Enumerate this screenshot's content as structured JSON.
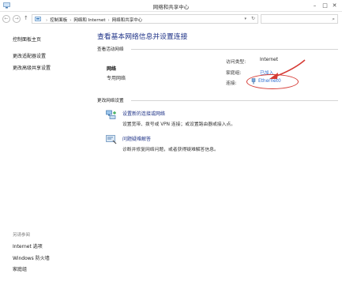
{
  "window": {
    "title": "网络和共享中心",
    "controls": {
      "minimize": "–",
      "maximize": "□",
      "close": "✕"
    }
  },
  "address": {
    "crumbs": [
      "控制面板",
      "网络和 Internet",
      "网络和共享中心"
    ],
    "nav_back": "←",
    "nav_forward": "→",
    "nav_up": "↑"
  },
  "sidebar": {
    "items": [
      {
        "label": "控制面板主页"
      },
      {
        "label": "更改适配器设置"
      },
      {
        "label": "更改高级共享设置"
      }
    ]
  },
  "see_also": {
    "title": "另请参阅",
    "items": [
      {
        "label": "Internet 选项"
      },
      {
        "label": "Windows 防火墙"
      },
      {
        "label": "家庭组"
      }
    ]
  },
  "main": {
    "title": "查看基本网络信息并设置连接",
    "active_networks_heading": "查看活动网络",
    "network": {
      "name": "网络",
      "type": "专用网络",
      "access_type_label": "访问类型:",
      "access_type_value": "Internet",
      "homegroup_label": "家庭组:",
      "homegroup_value": "已加入",
      "connections_label": "连接:",
      "connections_value": "Ethernet0"
    },
    "change_settings_heading": "更改网络设置",
    "tasks": [
      {
        "icon": "network-setup-icon",
        "link": "设置新的连接或网络",
        "description": "设置宽带、拨号或 VPN 连接；或设置路由器或接入点。"
      },
      {
        "icon": "troubleshoot-icon",
        "link": "问题疑难解答",
        "description": "诊断并修复网络问题，或者获得疑难解答信息。"
      }
    ]
  },
  "colors": {
    "title_blue": "#1e3287",
    "link_blue": "#2a6bd0",
    "annotation_red": "#d63b35"
  }
}
